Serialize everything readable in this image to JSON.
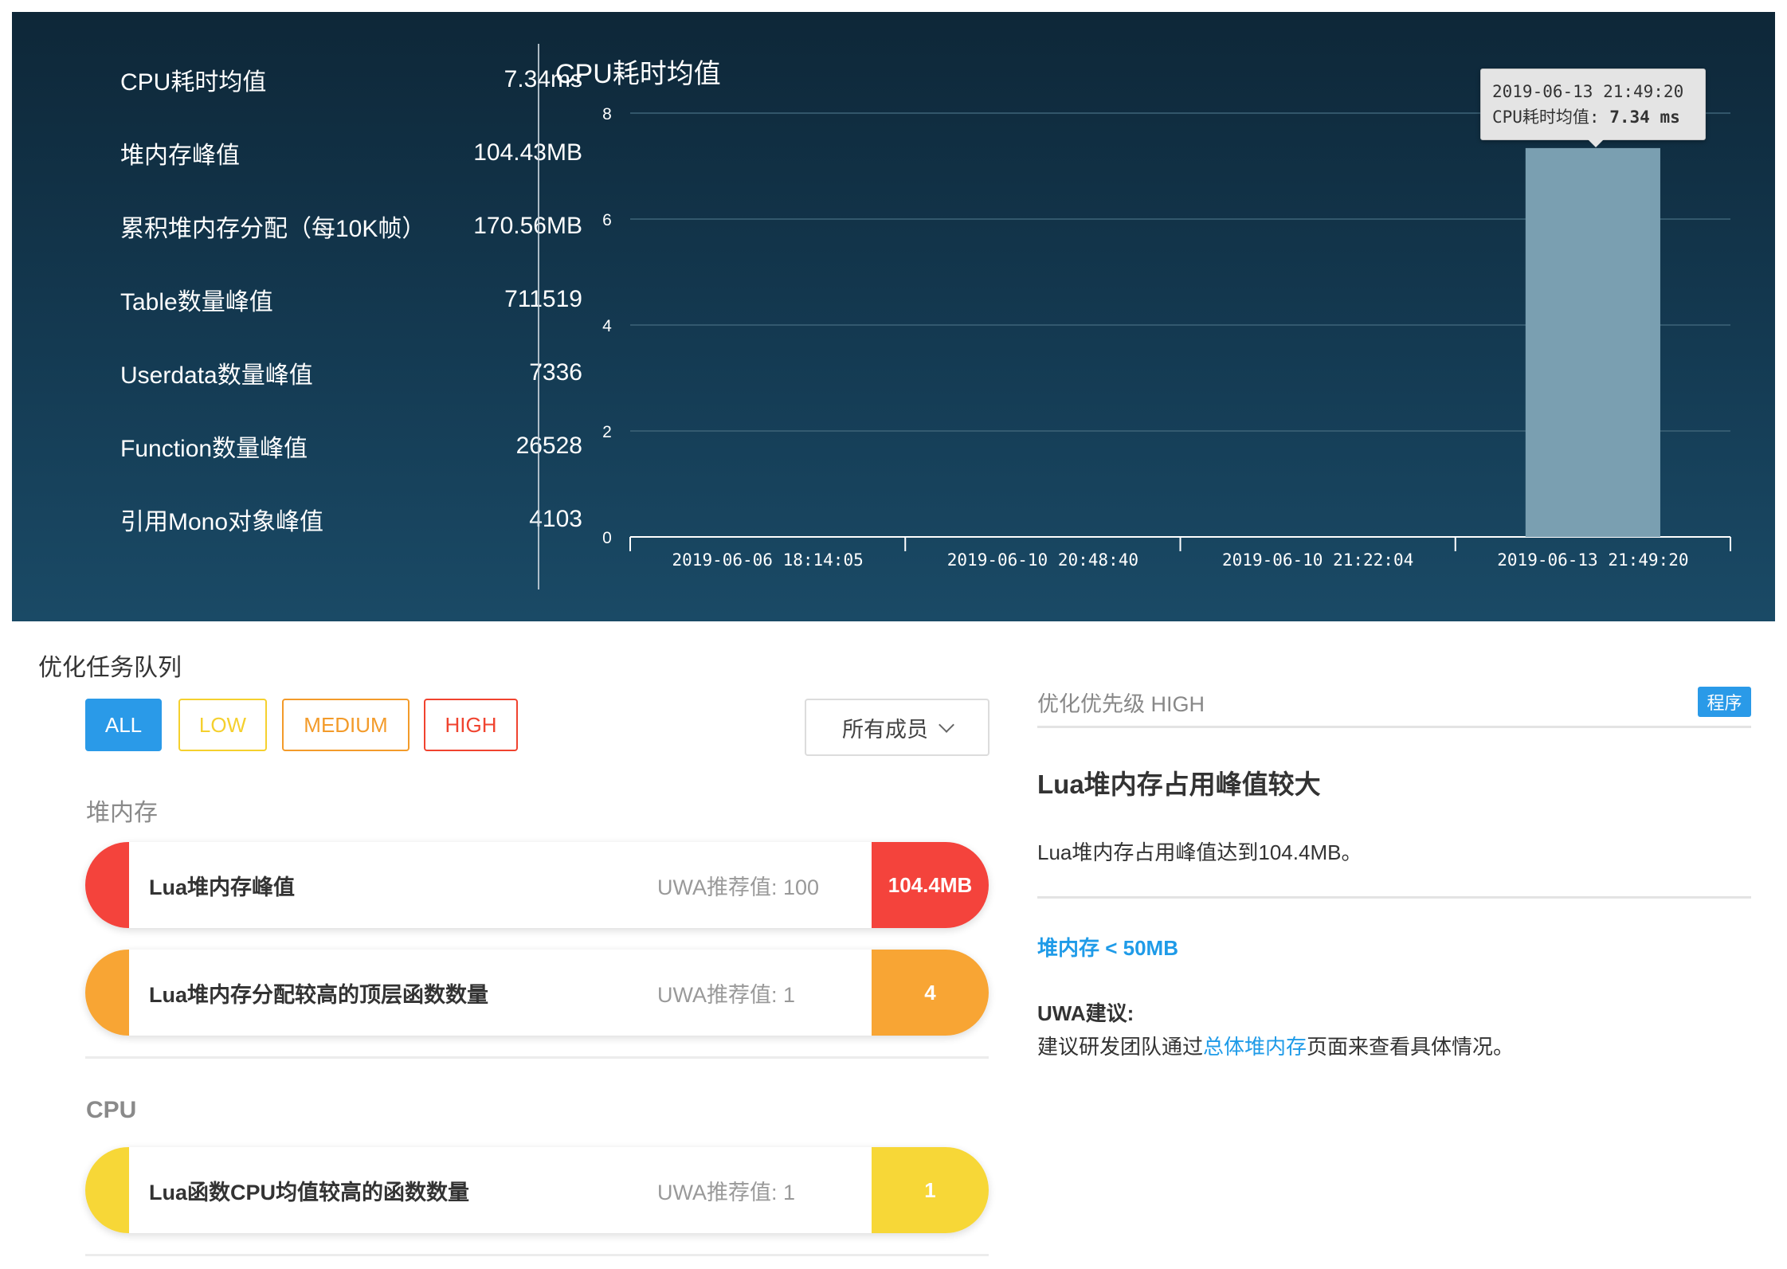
{
  "stats": [
    {
      "label": "CPU耗时均值",
      "value": "7.34ms"
    },
    {
      "label": "堆内存峰值",
      "value": "104.43MB"
    },
    {
      "label": "累积堆内存分配（每10K帧）",
      "value": "170.56MB"
    },
    {
      "label": "Table数量峰值",
      "value": "711519"
    },
    {
      "label": "Userdata数量峰值",
      "value": "7336"
    },
    {
      "label": "Function数量峰值",
      "value": "26528"
    },
    {
      "label": "引用Mono对象峰值",
      "value": "4103"
    }
  ],
  "chart_data": {
    "type": "bar",
    "title": "CPU耗时均值",
    "categories": [
      "2019-06-06 18:14:05",
      "2019-06-10 20:48:40",
      "2019-06-10 21:22:04",
      "2019-06-13 21:49:20"
    ],
    "series": [
      {
        "values": [
          0,
          0,
          0,
          7.34
        ]
      }
    ],
    "ylim": [
      0,
      8
    ],
    "yticks": [
      "0",
      "2",
      "4",
      "6",
      "8"
    ],
    "grid": true,
    "bar_color": "#7a9fb1",
    "tooltip": {
      "time": "2019-06-13 21:49:20",
      "label": "CPU耗时均值:",
      "value": "7.34 ms"
    }
  },
  "queue": {
    "title": "优化任务队列",
    "filters": [
      {
        "label": "ALL",
        "color": "#2a9ae8",
        "active": true
      },
      {
        "label": "LOW",
        "color": "#f5d02e",
        "active": false
      },
      {
        "label": "MEDIUM",
        "color": "#f39b2a",
        "active": false
      },
      {
        "label": "HIGH",
        "color": "#f0432f",
        "active": false
      }
    ],
    "member_select": "所有成员",
    "groups": [
      {
        "title": "堆内存",
        "tasks": [
          {
            "name": "Lua堆内存峰值",
            "rec": "UWA推荐值: 100",
            "value": "104.4MB",
            "color": "#f4433c"
          },
          {
            "name": "Lua堆内存分配较高的顶层函数数量",
            "rec": "UWA推荐值: 1",
            "value": "4",
            "color": "#f8a534"
          }
        ]
      },
      {
        "title": "CPU",
        "tasks": [
          {
            "name": "Lua函数CPU均值较高的函数数量",
            "rec": "UWA推荐值: 1",
            "value": "1",
            "color": "#f7d737"
          }
        ]
      }
    ]
  },
  "detail": {
    "priority": "优化优先级 HIGH",
    "tag": "程序",
    "title": "Lua堆内存占用峰值较大",
    "description": "Lua堆内存占用峰值达到104.4MB。",
    "metric": "堆内存 < 50MB",
    "advice_title": "UWA建议:",
    "advice_before": "建议研发团队通过",
    "advice_link": "总体堆内存",
    "advice_after": "页面来查看具体情况。"
  }
}
